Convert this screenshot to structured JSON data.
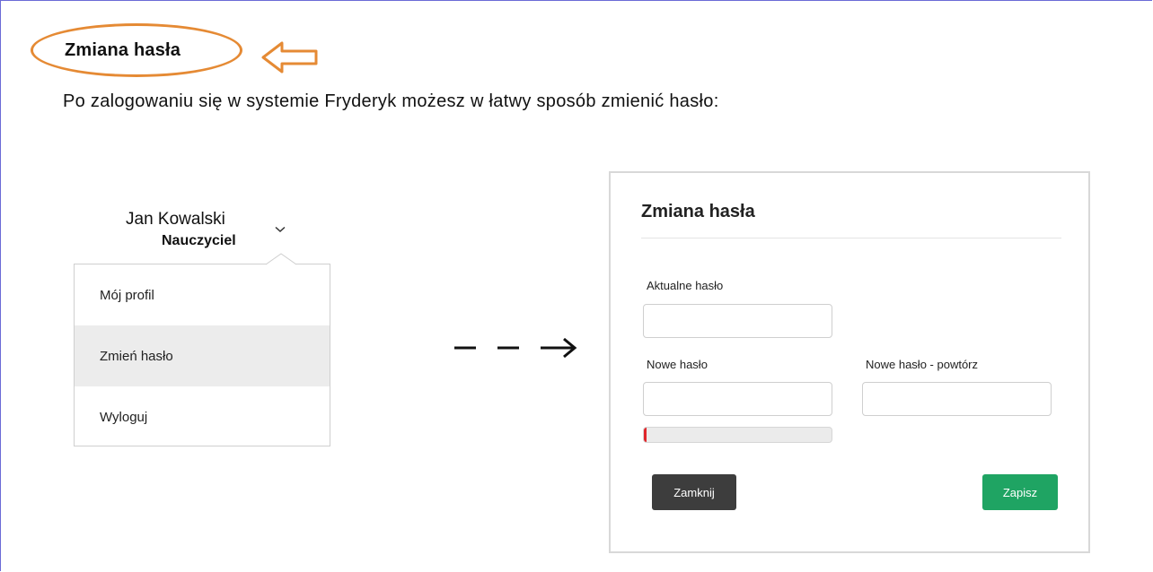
{
  "instructions": {
    "heading": "Zmiana hasła",
    "intro": "Po zalogowaniu się w systemie Fryderyk możesz w łatwy sposób zmienić hasło:"
  },
  "user_menu": {
    "name": "Jan Kowalski",
    "role": "Nauczyciel",
    "items": [
      {
        "label": "Mój profil",
        "active": false
      },
      {
        "label": "Zmień hasło",
        "active": true
      },
      {
        "label": "Wyloguj",
        "active": false
      }
    ]
  },
  "dialog": {
    "title": "Zmiana hasła",
    "current_password_label": "Aktualne hasło",
    "current_password_value": "",
    "new_password_label": "Nowe hasło",
    "new_password_value": "",
    "repeat_password_label": "Nowe hasło - powtórz",
    "repeat_password_value": "",
    "strength_fraction": 0.01,
    "close_label": "Zamknij",
    "save_label": "Zapisz"
  },
  "colors": {
    "highlight": "#e58a34",
    "strength_weak": "#e0262b",
    "close_button": "#3d3d3d",
    "save_button": "#1fa463"
  },
  "icons": {
    "hand_arrow": "left-arrow-outline-icon",
    "chevron": "chevron-down-icon",
    "flow_arrow": "dashed-right-arrow-icon"
  }
}
